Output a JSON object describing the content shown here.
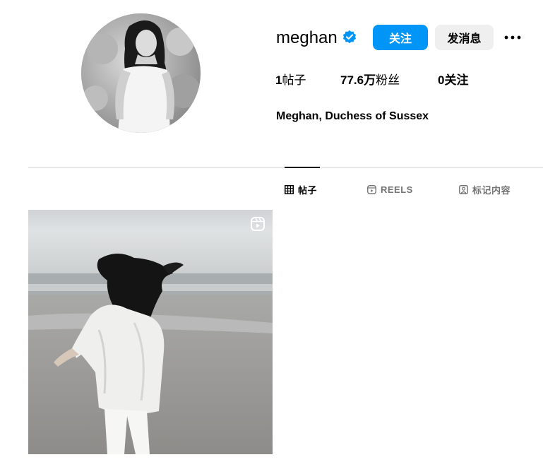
{
  "profile": {
    "username": "meghan",
    "verified": true,
    "full_name": "Meghan, Duchess of Sussex"
  },
  "actions": {
    "follow_label": "关注",
    "message_label": "发消息",
    "more_icon": "more-horizontal-icon"
  },
  "stats": {
    "posts_count": "1",
    "posts_label": "帖子",
    "followers_count": "77.6万",
    "followers_label": "粉丝",
    "following_count": "0",
    "following_label": "关注"
  },
  "tabs": [
    {
      "label": "帖子",
      "icon": "grid-icon",
      "active": true
    },
    {
      "label": "REELS",
      "icon": "reels-icon",
      "active": false
    },
    {
      "label": "标记内容",
      "icon": "tagged-icon",
      "active": false
    }
  ],
  "posts": [
    {
      "type": "reel",
      "icon": "reel-badge-icon"
    }
  ],
  "colors": {
    "accent": "#0095f6",
    "secondary_button": "#efefef",
    "divider": "#dbdbdb",
    "muted_text": "#737373"
  }
}
